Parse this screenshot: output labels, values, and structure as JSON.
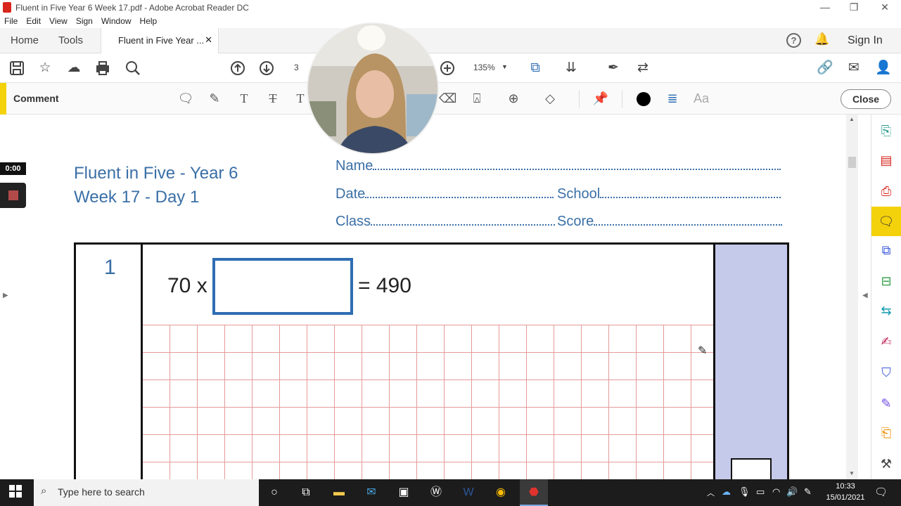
{
  "window": {
    "title": "Fluent in Five Year 6 Week 17.pdf - Adobe Acrobat Reader DC"
  },
  "menu": [
    "File",
    "Edit",
    "View",
    "Sign",
    "Window",
    "Help"
  ],
  "tabs": {
    "home": "Home",
    "tools": "Tools",
    "document": "Fluent in Five Year ...",
    "sign_in": "Sign In"
  },
  "toolbar": {
    "page_number": "3",
    "zoom": "135%"
  },
  "comment_bar": {
    "label": "Comment",
    "close": "Close",
    "font_label": "Aa"
  },
  "recorder": {
    "timer": "0:00"
  },
  "document": {
    "title_line1": "Fluent in Five - Year 6",
    "title_line2": "Week 17 - Day 1",
    "name_label": "Name",
    "date_label": "Date",
    "school_label": "School",
    "class_label": "Class",
    "score_label": "Score",
    "question_number": "1",
    "equation_left": "70 x",
    "equation_right": "= 490"
  },
  "taskbar": {
    "search_placeholder": "Type here to search",
    "time": "10:33",
    "date": "15/01/2021"
  },
  "colors": {
    "accent_yellow": "#f4d20b",
    "doc_blue": "#3a6fa6",
    "grid_red": "#e59a9a",
    "score_column": "#c5c9ea",
    "answer_box": "#2f6db3"
  }
}
